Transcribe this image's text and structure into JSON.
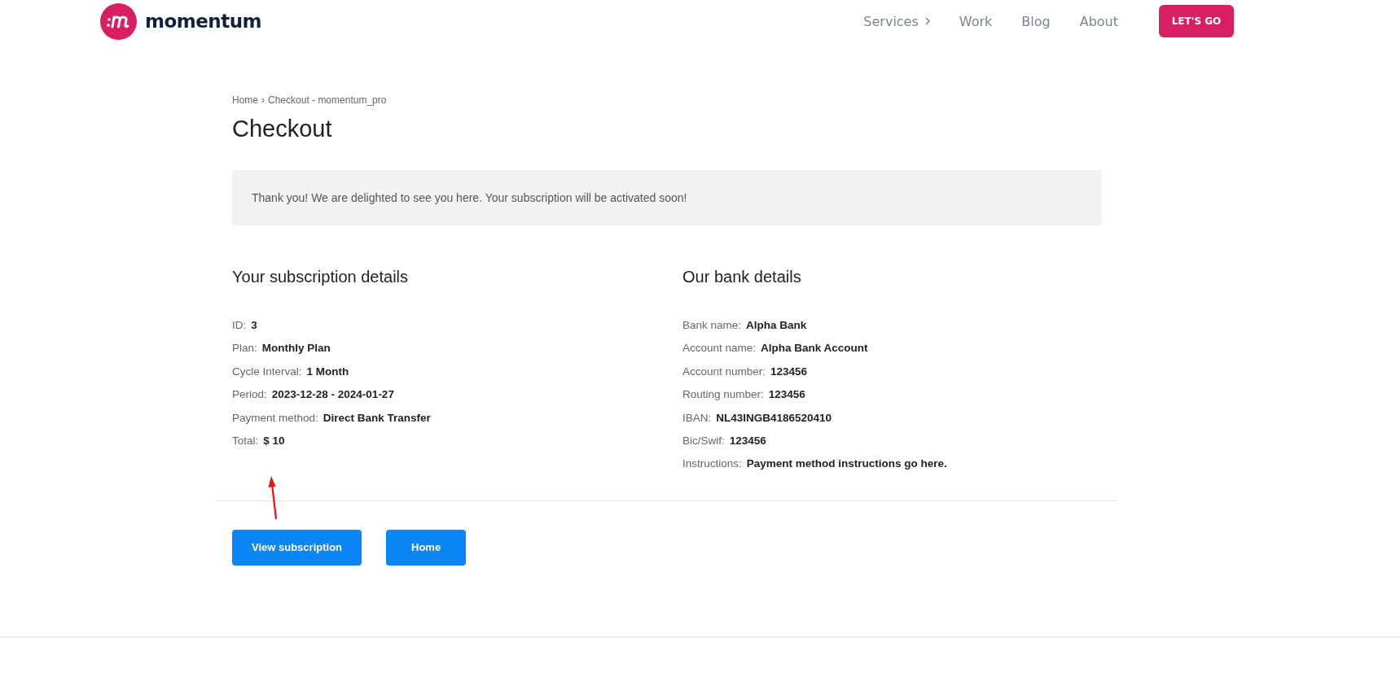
{
  "header": {
    "logo_text": "momentum",
    "nav": [
      {
        "label": "Services",
        "has_submenu": true
      },
      {
        "label": "Work",
        "has_submenu": false
      },
      {
        "label": "Blog",
        "has_submenu": false
      },
      {
        "label": "About",
        "has_submenu": false
      }
    ],
    "cta": "LET'S GO"
  },
  "breadcrumb": {
    "separator": "›",
    "items": [
      "Home",
      "Checkout - momentum_pro"
    ]
  },
  "title": "Checkout",
  "notice": "Thank you! We are delighted to see you here. Your subscription will be activated soon!",
  "sections": [
    {
      "heading": "Your subscription details",
      "rows": [
        {
          "label": "ID:",
          "value": "3"
        },
        {
          "label": "Plan:",
          "value": "Monthly Plan"
        },
        {
          "label": "Cycle Interval:",
          "value": "1 Month"
        },
        {
          "label": "Period:",
          "value": "2023-12-28 - 2024-01-27"
        },
        {
          "label": "Payment method:",
          "value": "Direct Bank Transfer"
        },
        {
          "label": "Total:",
          "value": "$ 10"
        }
      ]
    },
    {
      "heading": "Our bank details",
      "rows": [
        {
          "label": "Bank name:",
          "value": "Alpha Bank"
        },
        {
          "label": "Account name:",
          "value": "Alpha Bank Account"
        },
        {
          "label": "Account number:",
          "value": "123456"
        },
        {
          "label": "Routing number:",
          "value": "123456"
        },
        {
          "label": "IBAN:",
          "value": "NL43INGB4186520410"
        },
        {
          "label": "Bic/Swif:",
          "value": "123456"
        },
        {
          "label": "Instructions:",
          "value": "Payment method instructions go here."
        }
      ]
    }
  ],
  "buttons": [
    "View subscription",
    "Home"
  ]
}
